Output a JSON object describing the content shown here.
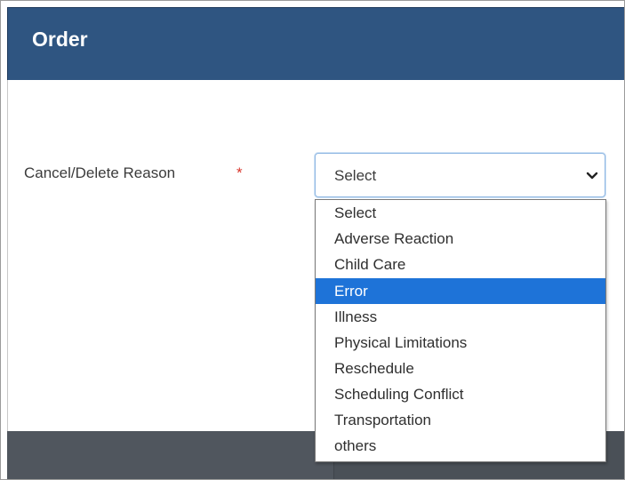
{
  "dialog": {
    "title": "Order"
  },
  "form": {
    "reason_label": "Cancel/Delete Reason",
    "required_marker": "*",
    "reason_select_value": "Select"
  },
  "dropdown": {
    "options": [
      "Select",
      "Adverse Reaction",
      "Child Care",
      "Error",
      "Illness",
      "Physical Limitations",
      "Reschedule",
      "Scheduling Conflict",
      "Transportation",
      "others"
    ],
    "highlighted": "Error"
  },
  "colors": {
    "header_bg": "#2f5581",
    "highlight_bg": "#1e73d8",
    "required": "#d9352b"
  },
  "icons": {
    "select_arrow": "chevron-down-icon"
  }
}
